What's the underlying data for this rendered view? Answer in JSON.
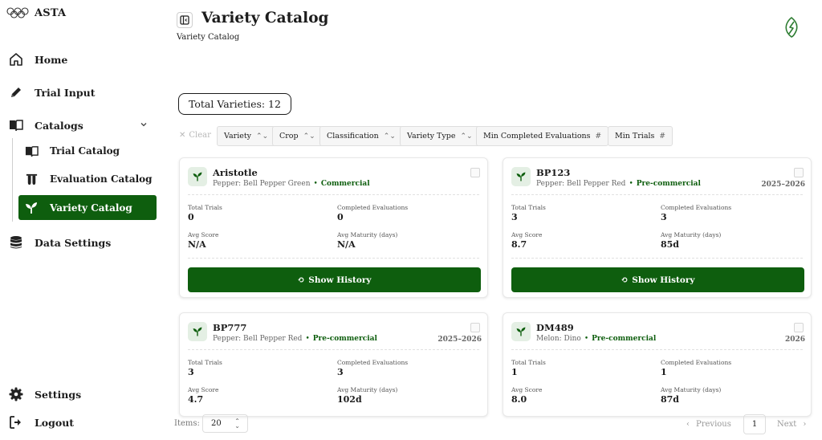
{
  "app": {
    "name": "ASTA"
  },
  "sidebar": {
    "home": "Home",
    "trial_input": "Trial Input",
    "catalogs": "Catalogs",
    "trial_catalog": "Trial Catalog",
    "evaluation_catalog": "Evaluation Catalog",
    "variety_catalog": "Variety Catalog",
    "data_settings": "Data Settings",
    "settings": "Settings",
    "logout": "Logout"
  },
  "header": {
    "title": "Variety Catalog",
    "breadcrumb": "Variety Catalog"
  },
  "summary": {
    "total": "Total Varieties: 12"
  },
  "filters": {
    "clear": "Clear",
    "chips": [
      "Variety",
      "Crop",
      "Classification",
      "Variety Type",
      "Min Completed Evaluations",
      "Min Trials"
    ]
  },
  "stat_labels": {
    "total_trials": "Total Trials",
    "completed_evaluations": "Completed Evaluations",
    "avg_score": "Avg Score",
    "avg_maturity": "Avg Maturity (days)"
  },
  "cards": [
    {
      "name": "Aristotle",
      "crop": "Pepper: Bell Pepper Green",
      "classification": "Commercial",
      "years": "",
      "total_trials": "0",
      "completed_evaluations": "0",
      "avg_score": "N/A",
      "avg_maturity": "N/A",
      "button": "Show History"
    },
    {
      "name": "BP123",
      "crop": "Pepper: Bell Pepper Red",
      "classification": "Pre-commercial",
      "years": "2025–2026",
      "total_trials": "3",
      "completed_evaluations": "3",
      "avg_score": "8.7",
      "avg_maturity": "85d",
      "button": "Show History"
    },
    {
      "name": "BP777",
      "crop": "Pepper: Bell Pepper Red",
      "classification": "Pre-commercial",
      "years": "2025–2026",
      "total_trials": "3",
      "completed_evaluations": "3",
      "avg_score": "4.7",
      "avg_maturity": "102d",
      "button": "Show History"
    },
    {
      "name": "DM489",
      "crop": "Melon: Dino",
      "classification": "Pre-commercial",
      "years": "2026",
      "total_trials": "1",
      "completed_evaluations": "1",
      "avg_score": "8.0",
      "avg_maturity": "87d",
      "button": "Show History"
    }
  ],
  "pagination": {
    "items_label": "Items:",
    "items_value": "20",
    "previous": "Previous",
    "page": "1",
    "next": "Next"
  },
  "colors": {
    "accent": "#0e5e0e",
    "accent_soft": "#e4efe4"
  }
}
